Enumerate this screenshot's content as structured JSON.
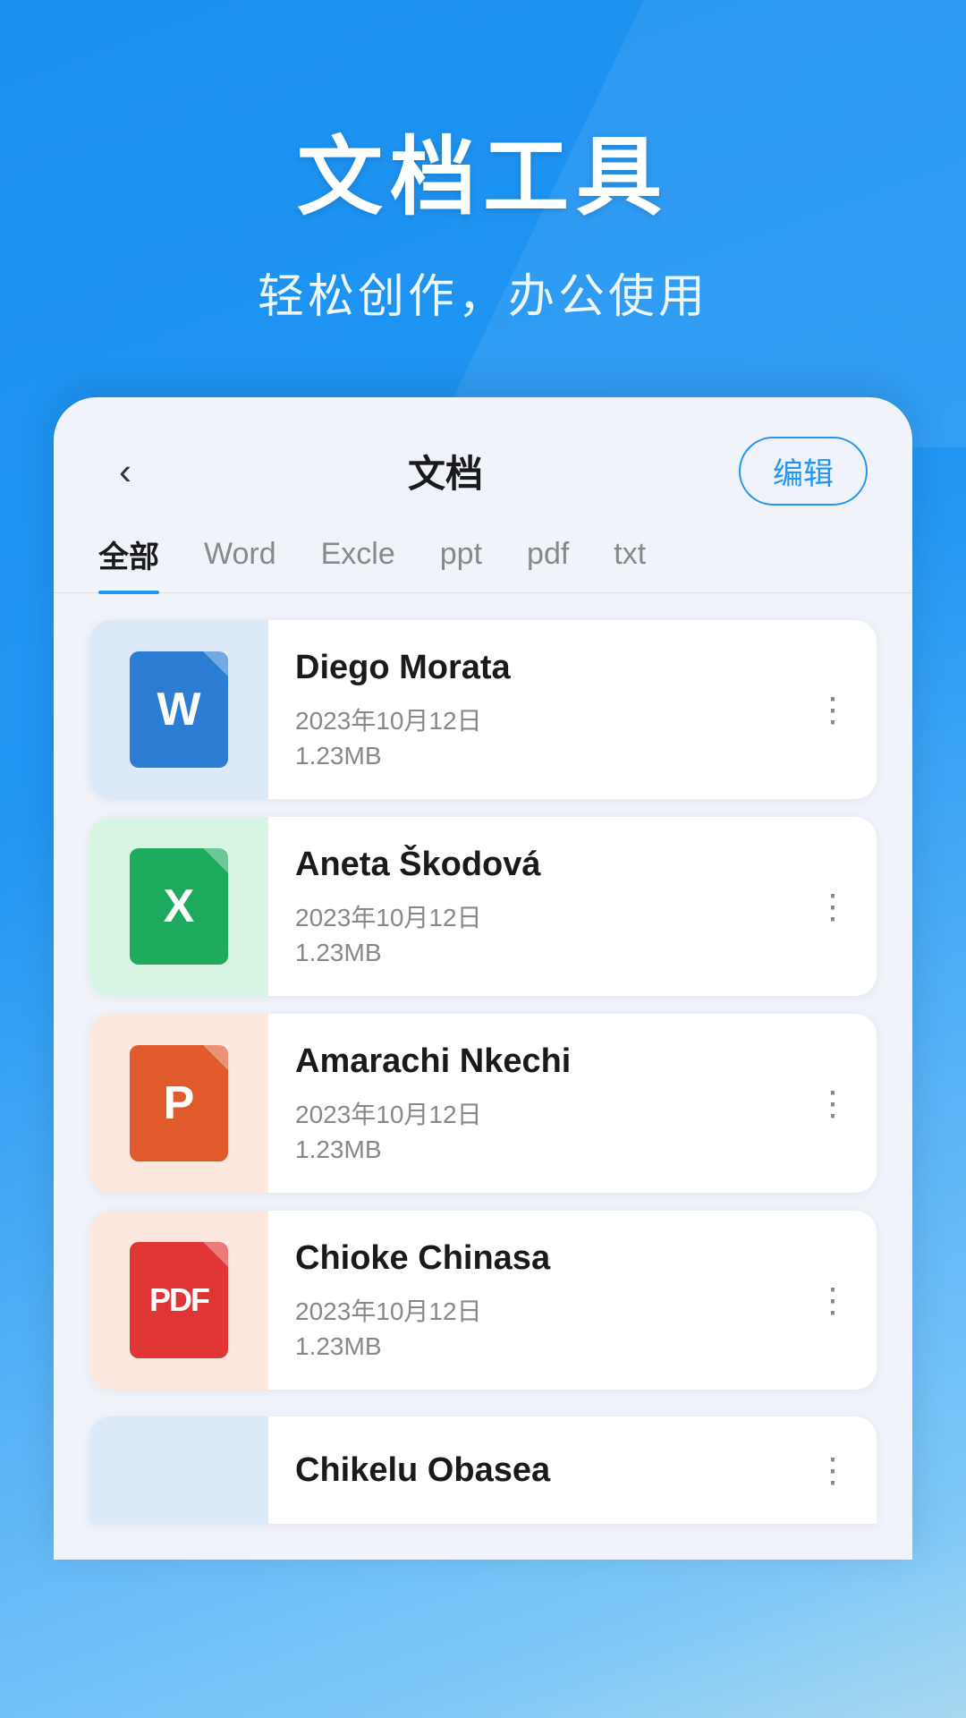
{
  "header": {
    "main_title": "文档工具",
    "subtitle": "轻松创作，办公使用"
  },
  "nav": {
    "back_label": "‹",
    "title": "文档",
    "edit_label": "编辑"
  },
  "tabs": [
    {
      "id": "all",
      "label": "全部",
      "active": true
    },
    {
      "id": "word",
      "label": "Word",
      "active": false
    },
    {
      "id": "excel",
      "label": "Excle",
      "active": false
    },
    {
      "id": "ppt",
      "label": "ppt",
      "active": false
    },
    {
      "id": "pdf",
      "label": "pdf",
      "active": false
    },
    {
      "id": "txt",
      "label": "txt",
      "active": false
    }
  ],
  "files": [
    {
      "id": 1,
      "name": "Diego Morata",
      "date": "2023年10月12日",
      "size": "1.23MB",
      "type": "word",
      "icon_label": "W",
      "bg_class": "word-bg",
      "icon_class": "word"
    },
    {
      "id": 2,
      "name": "Aneta Škodová",
      "date": "2023年10月12日",
      "size": "1.23MB",
      "type": "excel",
      "icon_label": "X",
      "bg_class": "excel-bg",
      "icon_class": "excel"
    },
    {
      "id": 3,
      "name": "Amarachi Nkechi",
      "date": "2023年10月12日",
      "size": "1.23MB",
      "type": "ppt",
      "icon_label": "P",
      "bg_class": "ppt-bg",
      "icon_class": "ppt"
    },
    {
      "id": 4,
      "name": "Chioke Chinasa",
      "date": "2023年10月12日",
      "size": "1.23MB",
      "type": "pdf",
      "icon_label": "PDF",
      "bg_class": "pdf-bg",
      "icon_class": "pdf"
    }
  ],
  "partial_file": {
    "name": "Chikelu Obasea"
  },
  "more_icon": "⋮",
  "colors": {
    "accent": "#2196f3",
    "word": "#2b7cd3",
    "excel": "#1daa5c",
    "ppt": "#e05a2b",
    "pdf": "#e03535"
  }
}
